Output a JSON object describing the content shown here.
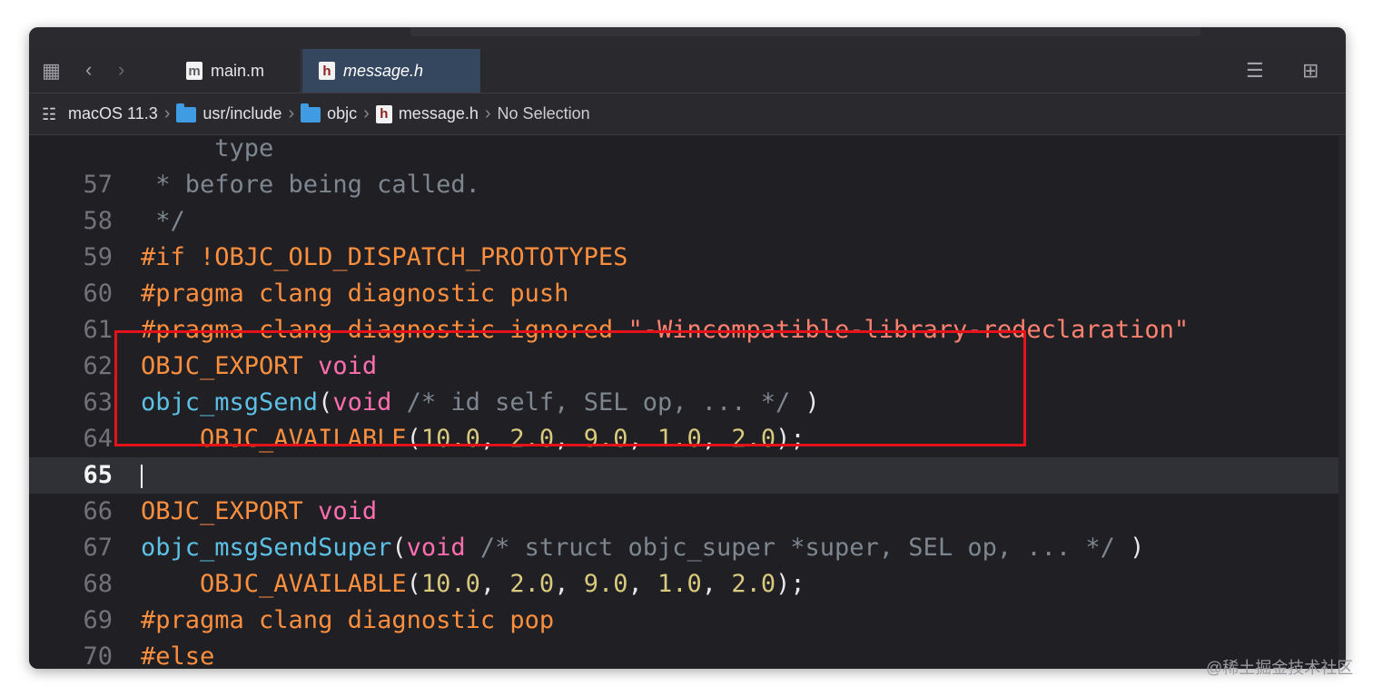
{
  "tabs": [
    {
      "label": "main.m",
      "icon": "m",
      "active": false
    },
    {
      "label": "message.h",
      "icon": "h",
      "active": true
    }
  ],
  "breadcrumb": {
    "sdk": "macOS 11.3",
    "folder1": "usr/include",
    "folder2": "objc",
    "file": "message.h",
    "selection": "No Selection"
  },
  "editor": {
    "lines": [
      {
        "num": "",
        "tokens": [
          {
            "c": "cmt",
            "t": "     type"
          }
        ]
      },
      {
        "num": "57",
        "tokens": [
          {
            "c": "cmt",
            "t": " * before being called."
          }
        ]
      },
      {
        "num": "58",
        "tokens": [
          {
            "c": "cmt",
            "t": " */"
          }
        ]
      },
      {
        "num": "59",
        "tokens": [
          {
            "c": "pp",
            "t": "#if !OBJC_OLD_DISPATCH_PROTOTYPES"
          }
        ]
      },
      {
        "num": "60",
        "tokens": [
          {
            "c": "pp",
            "t": "#pragma clang diagnostic push"
          }
        ]
      },
      {
        "num": "61",
        "tokens": [
          {
            "c": "pp",
            "t": "#pragma clang diagnostic ignored "
          },
          {
            "c": "str",
            "t": "\"-Wincompatible-library-redeclaration\""
          }
        ]
      },
      {
        "num": "62",
        "tokens": [
          {
            "c": "pp",
            "t": "OBJC_EXPORT "
          },
          {
            "c": "kw",
            "t": "void"
          }
        ]
      },
      {
        "num": "63",
        "tokens": [
          {
            "c": "fn",
            "t": "objc_msgSend"
          },
          {
            "c": "pl",
            "t": "("
          },
          {
            "c": "kw",
            "t": "void"
          },
          {
            "c": "cmt",
            "t": " /* id self, SEL op, ... */"
          },
          {
            "c": "pl",
            "t": " )"
          }
        ]
      },
      {
        "num": "64",
        "tokens": [
          {
            "c": "pl",
            "t": "    "
          },
          {
            "c": "pp",
            "t": "OBJC_AVAILABLE"
          },
          {
            "c": "pl",
            "t": "("
          },
          {
            "c": "num",
            "t": "10.0"
          },
          {
            "c": "pl",
            "t": ", "
          },
          {
            "c": "num",
            "t": "2.0"
          },
          {
            "c": "pl",
            "t": ", "
          },
          {
            "c": "num",
            "t": "9.0"
          },
          {
            "c": "pl",
            "t": ", "
          },
          {
            "c": "num",
            "t": "1.0"
          },
          {
            "c": "pl",
            "t": ", "
          },
          {
            "c": "num",
            "t": "2.0"
          },
          {
            "c": "pl",
            "t": ");"
          }
        ]
      },
      {
        "num": "65",
        "current": true,
        "tokens": []
      },
      {
        "num": "66",
        "tokens": [
          {
            "c": "pp",
            "t": "OBJC_EXPORT "
          },
          {
            "c": "kw",
            "t": "void"
          }
        ]
      },
      {
        "num": "67",
        "tokens": [
          {
            "c": "fn",
            "t": "objc_msgSendSuper"
          },
          {
            "c": "pl",
            "t": "("
          },
          {
            "c": "kw",
            "t": "void"
          },
          {
            "c": "cmt",
            "t": " /* struct objc_super *super, SEL op, ... */"
          },
          {
            "c": "pl",
            "t": " )"
          }
        ]
      },
      {
        "num": "68",
        "tokens": [
          {
            "c": "pl",
            "t": "    "
          },
          {
            "c": "pp",
            "t": "OBJC_AVAILABLE"
          },
          {
            "c": "pl",
            "t": "("
          },
          {
            "c": "num",
            "t": "10.0"
          },
          {
            "c": "pl",
            "t": ", "
          },
          {
            "c": "num",
            "t": "2.0"
          },
          {
            "c": "pl",
            "t": ", "
          },
          {
            "c": "num",
            "t": "9.0"
          },
          {
            "c": "pl",
            "t": ", "
          },
          {
            "c": "num",
            "t": "1.0"
          },
          {
            "c": "pl",
            "t": ", "
          },
          {
            "c": "num",
            "t": "2.0"
          },
          {
            "c": "pl",
            "t": ");"
          }
        ]
      },
      {
        "num": "69",
        "tokens": [
          {
            "c": "pp",
            "t": "#pragma clang diagnostic pop"
          }
        ]
      },
      {
        "num": "70",
        "tokens": [
          {
            "c": "pp",
            "t": "#else"
          }
        ]
      }
    ]
  },
  "watermark": "@稀土掘金技术社区",
  "colors": {
    "background": "#1f1f24",
    "preprocessor": "#fd8f3f",
    "keyword": "#ff6fb0",
    "function": "#5dc1e6",
    "number": "#d9c97c",
    "string": "#ff8170",
    "comment": "#7e8690",
    "highlight_box": "#e5121a"
  }
}
